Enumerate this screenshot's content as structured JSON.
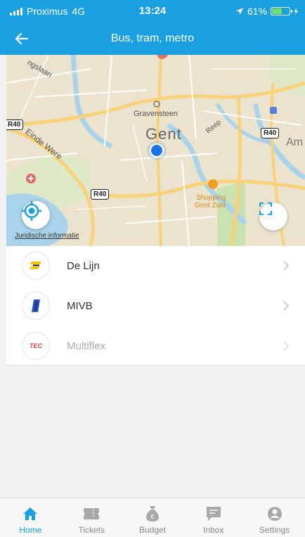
{
  "status_bar": {
    "carrier": "Proximus",
    "network": "4G",
    "time": "13:24",
    "battery_percent": "61%",
    "battery_level": 0.61
  },
  "header": {
    "title": "Bus, tram, metro",
    "back_icon": "arrow-left-icon"
  },
  "map": {
    "city": "Gent",
    "places": {
      "gravensteen": "Gravensteen",
      "shopping": "Shopping",
      "shopping_sub": "Gent Zuid",
      "street_1": "ngslaan",
      "street_2": "Einde Were",
      "street_3": "Reep",
      "partial_am": "Am"
    },
    "road_badge": "R40",
    "legal_link": "Juridische informatie",
    "locate_icon": "crosshair-icon",
    "fullscreen_icon": "fullscreen-icon"
  },
  "operators": [
    {
      "name": "De Lijn",
      "enabled": true,
      "logo": "de-lijn-logo"
    },
    {
      "name": "MIVB",
      "enabled": true,
      "logo": "mivb-logo"
    },
    {
      "name": "Multiflex",
      "enabled": false,
      "logo": "tec-logo",
      "logo_text": "TEC"
    }
  ],
  "tabs": [
    {
      "label": "Home",
      "icon": "home-icon",
      "active": true
    },
    {
      "label": "Tickets",
      "icon": "ticket-icon",
      "active": false
    },
    {
      "label": "Budget",
      "icon": "money-bag-icon",
      "active": false
    },
    {
      "label": "Inbox",
      "icon": "message-icon",
      "active": false
    },
    {
      "label": "Settings",
      "icon": "user-icon",
      "active": false
    }
  ],
  "colors": {
    "primary": "#1aa0e0",
    "map_background": "#ece3cf",
    "water": "#a8d3ea",
    "park": "#c9e2b0",
    "roads_major": "#f7d27a",
    "location_dot": "#1a73e8"
  }
}
